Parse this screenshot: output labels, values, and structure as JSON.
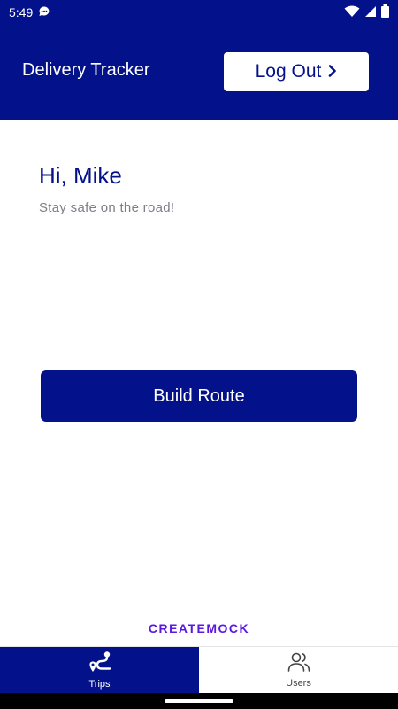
{
  "status_bar": {
    "time": "5:49",
    "icons": [
      "chat-bubble-icon",
      "wifi-icon",
      "signal-icon",
      "battery-icon"
    ]
  },
  "header": {
    "title": "Delivery Tracker",
    "logout_label": "Log Out",
    "logout_icon": "chevron-right-icon"
  },
  "main": {
    "greeting": "Hi, Mike",
    "subtext": "Stay safe on the road!",
    "build_route_label": "Build Route"
  },
  "watermark": "CREATEMOCK",
  "bottom_nav": {
    "items": [
      {
        "label": "Trips",
        "icon": "route-icon",
        "active": true
      },
      {
        "label": "Users",
        "icon": "users-icon",
        "active": false
      }
    ]
  },
  "colors": {
    "primary": "#03128a",
    "watermark": "#5a18e0",
    "subtext": "#7b7f88"
  }
}
